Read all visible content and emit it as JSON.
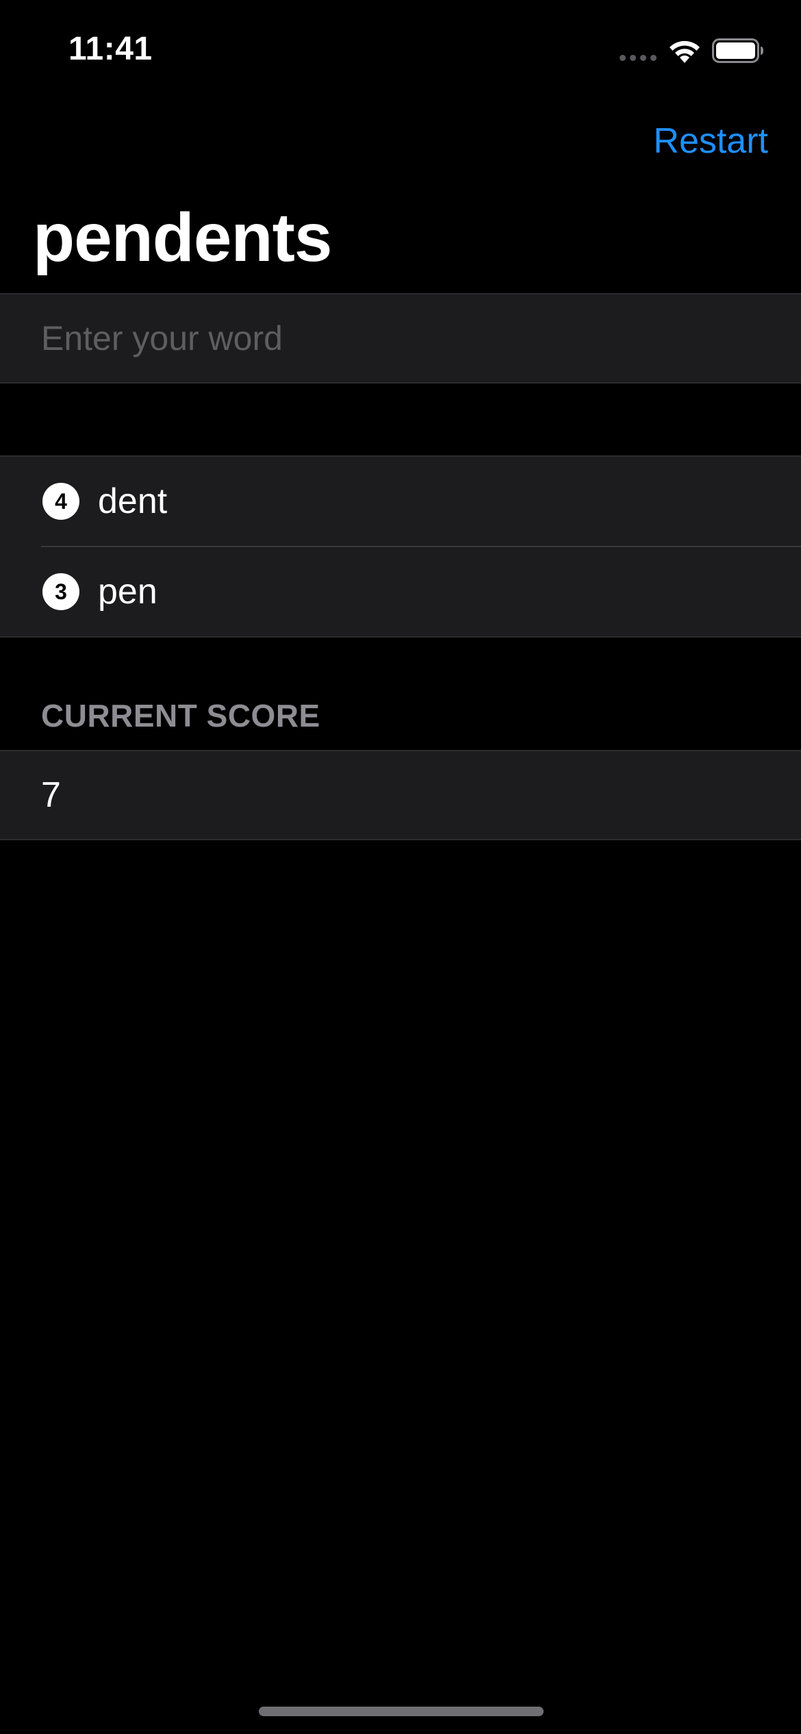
{
  "status_bar": {
    "time": "11:41",
    "signal_icon": "cellular-dots-icon",
    "wifi_icon": "wifi-icon",
    "battery_icon": "battery-icon"
  },
  "nav": {
    "restart_label": "Restart",
    "title": "pendents"
  },
  "input": {
    "value": "",
    "placeholder": "Enter your word"
  },
  "used_words": [
    {
      "count": "4",
      "word": "dent"
    },
    {
      "count": "3",
      "word": "pen"
    }
  ],
  "score": {
    "header": "CURRENT SCORE",
    "value": "7"
  },
  "colors": {
    "background": "#000000",
    "cell_background": "#1c1c1e",
    "accent": "#1f8fff",
    "secondary_text": "#8d8d93"
  }
}
